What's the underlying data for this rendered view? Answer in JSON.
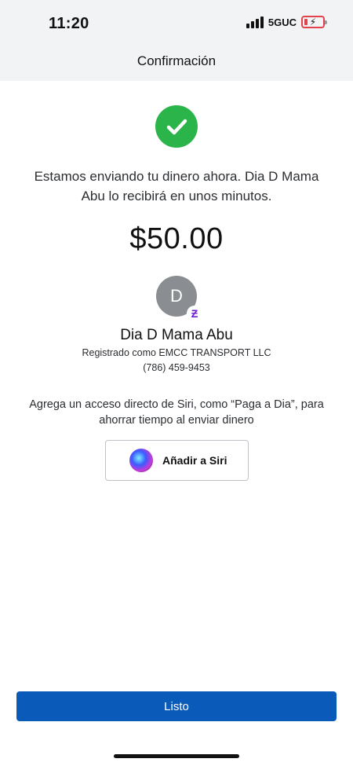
{
  "status_bar": {
    "time": "11:20",
    "network": "5GUC",
    "battery_level": 0.2,
    "battery_color": "#e0434b"
  },
  "nav": {
    "title": "Confirmación"
  },
  "confirmation": {
    "icon": "checkmark-circle-icon",
    "icon_color": "#2bb449",
    "message": "Estamos enviando tu dinero ahora. Dia D Mama Abu lo recibirá en unos minutos.",
    "amount": "$50.00"
  },
  "recipient": {
    "initial": "D",
    "badge_glyph": "Ƶ",
    "name": "Dia D Mama Abu",
    "registered_as": "Registrado como EMCC TRANSPORT LLC",
    "phone": "(786) 459-9453"
  },
  "siri": {
    "prompt": "Agrega un acceso directo de Siri, como “Paga a Dia”, para ahorrar tiempo al enviar dinero",
    "button_label": "Añadir a Siri",
    "icon": "siri-icon"
  },
  "footer": {
    "done_label": "Listo",
    "accent": "#0a5bb9"
  }
}
